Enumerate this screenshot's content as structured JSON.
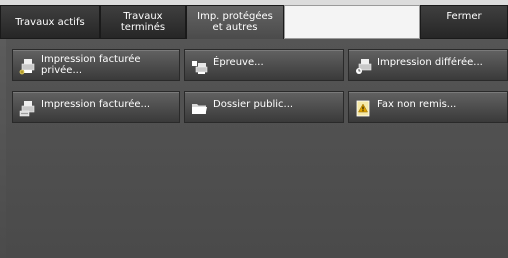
{
  "tabs": [
    {
      "label_line1": "Travaux actifs",
      "label_line2": ""
    },
    {
      "label_line1": "Travaux",
      "label_line2": "terminés"
    },
    {
      "label_line1": "Imp. protégées",
      "label_line2": "et autres"
    }
  ],
  "close_button": {
    "label": "Fermer"
  },
  "buttons": [
    {
      "line1": "Impression facturée",
      "line2": "privée...",
      "icon": "secure-print-icon"
    },
    {
      "line1": "Épreuve...",
      "line2": "",
      "icon": "proof-print-icon"
    },
    {
      "line1": "Impression différée...",
      "line2": "",
      "icon": "delayed-print-icon"
    },
    {
      "line1": "Impression facturée...",
      "line2": "",
      "icon": "charge-print-icon"
    },
    {
      "line1": "Dossier public...",
      "line2": "",
      "icon": "public-folder-icon"
    },
    {
      "line1": "Fax non remis...",
      "line2": "",
      "icon": "fax-undelivered-icon"
    }
  ]
}
